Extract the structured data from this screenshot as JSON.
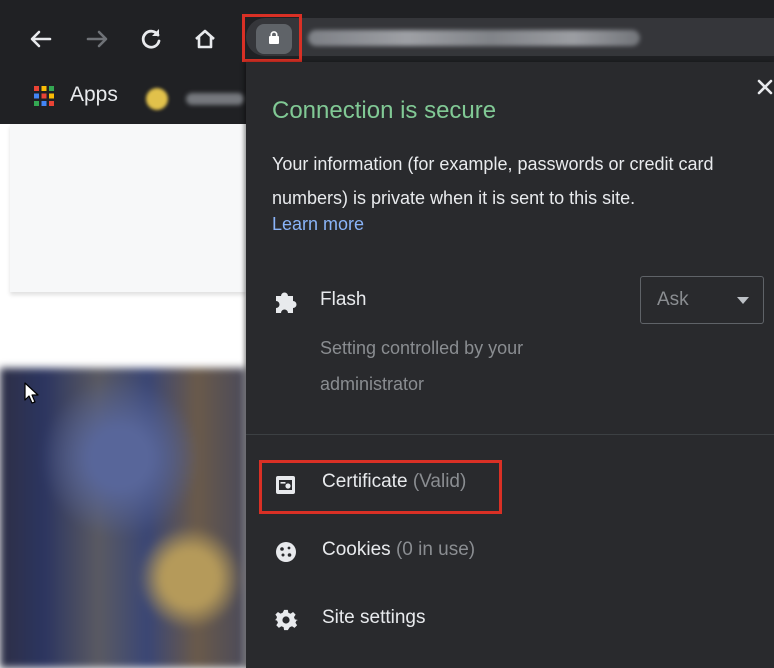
{
  "browser": {
    "nav": {
      "back_icon": "arrow-left-icon",
      "forward_icon": "arrow-right-icon",
      "reload_icon": "reload-icon",
      "home_icon": "home-icon"
    },
    "address_bar": {
      "lock_icon": "lock-icon",
      "highlight_color": "#d93025"
    },
    "bookmarks": {
      "apps_label": "Apps"
    }
  },
  "site_info": {
    "title": "Connection is secure",
    "title_color": "#81c995",
    "description": "Your information (for example, passwords or credit card numbers) is private when it is sent to this site.",
    "learn_more": "Learn more",
    "link_color": "#8ab4f8",
    "close_icon": "close-icon",
    "permissions": [
      {
        "icon": "puzzle-icon",
        "label": "Flash",
        "sublabel": "Setting controlled by your administrator",
        "value": "Ask"
      }
    ],
    "rows": [
      {
        "icon": "certificate-icon",
        "label": "Certificate",
        "note": "(Valid)"
      },
      {
        "icon": "cookie-icon",
        "label": "Cookies",
        "note": "(0 in use)"
      },
      {
        "icon": "gear-icon",
        "label": "Site settings"
      }
    ]
  }
}
